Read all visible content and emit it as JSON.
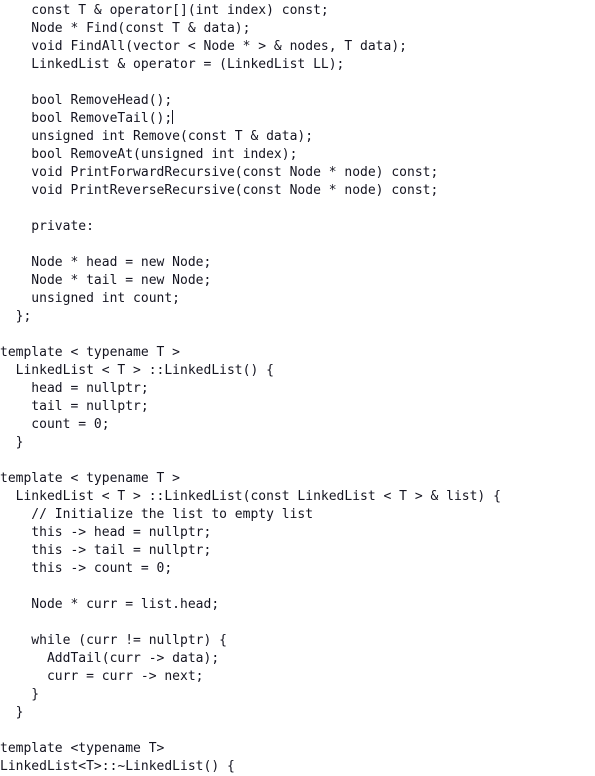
{
  "document": {
    "language": "cpp",
    "background_color": "#ffffff",
    "text_color": "#141420",
    "caret": {
      "present": true,
      "line_index": 6,
      "after_text": "bool RemoveTail();",
      "color": "#141420"
    },
    "lines": [
      "    const T & operator[](int index) const;",
      "    Node * Find(const T & data);",
      "    void FindAll(vector < Node * > & nodes, T data);",
      "    LinkedList & operator = (LinkedList LL);",
      "",
      "    bool RemoveHead();",
      "    bool RemoveTail();",
      "    unsigned int Remove(const T & data);",
      "    bool RemoveAt(unsigned int index);",
      "    void PrintForwardRecursive(const Node * node) const;",
      "    void PrintReverseRecursive(const Node * node) const;",
      "",
      "    private:",
      "",
      "    Node * head = new Node;",
      "    Node * tail = new Node;",
      "    unsigned int count;",
      "  };",
      "",
      "template < typename T >",
      "  LinkedList < T > ::LinkedList() {",
      "    head = nullptr;",
      "    tail = nullptr;",
      "    count = 0;",
      "  }",
      "",
      "template < typename T >",
      "  LinkedList < T > ::LinkedList(const LinkedList < T > & list) {",
      "    // Initialize the list to empty list",
      "    this -> head = nullptr;",
      "    this -> tail = nullptr;",
      "    this -> count = 0;",
      "",
      "    Node * curr = list.head;",
      "",
      "    while (curr != nullptr) {",
      "      AddTail(curr -> data);",
      "      curr = curr -> next;",
      "    }",
      "  }",
      "",
      "template <typename T>",
      "LinkedList<T>::~LinkedList() {"
    ]
  }
}
